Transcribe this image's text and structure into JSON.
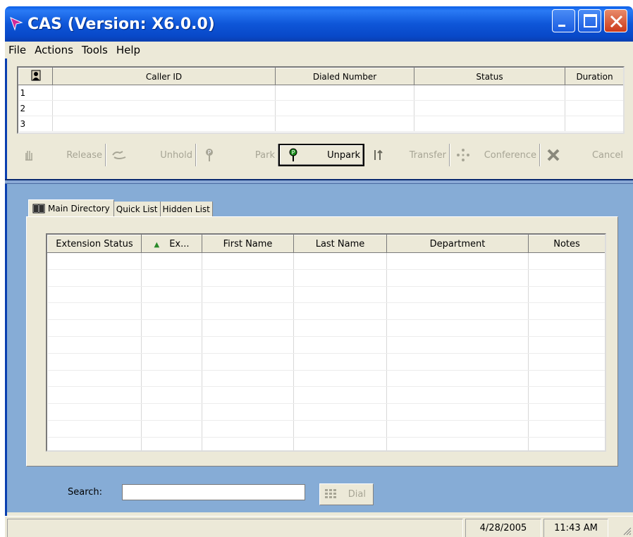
{
  "window": {
    "title": "CAS  (Version: X6.0.0)"
  },
  "menu": [
    "File",
    "Actions",
    "Tools",
    "Help"
  ],
  "calls_table": {
    "columns": [
      "Caller ID",
      "Dialed Number",
      "Status",
      "Duration"
    ],
    "rows": [
      {
        "num": "1",
        "caller_id": "",
        "dialed": "",
        "status": "",
        "duration": ""
      },
      {
        "num": "2",
        "caller_id": "",
        "dialed": "",
        "status": "",
        "duration": ""
      },
      {
        "num": "3",
        "caller_id": "",
        "dialed": "",
        "status": "",
        "duration": ""
      }
    ]
  },
  "toolbar": {
    "release": "Release",
    "unhold": "Unhold",
    "park": "Park",
    "unpark": "Unpark",
    "transfer": "Transfer",
    "conference": "Conference",
    "cancel": "Cancel"
  },
  "tabs": {
    "main_directory": "Main Directory",
    "quick_list": "Quick List",
    "hidden_list": "Hidden List"
  },
  "directory": {
    "columns": [
      "Extension Status",
      "Ex...",
      "First Name",
      "Last Name",
      "Department",
      "Notes"
    ],
    "sorted_column": "Ex..."
  },
  "search": {
    "label": "Search:",
    "value": ""
  },
  "dial_button": "Dial",
  "status_bar": {
    "date": "4/28/2005",
    "time": "11:43 AM"
  },
  "colors": {
    "titlebar": "#0a52d8",
    "frame": "#ece9d8",
    "lower_pane": "#86acd6",
    "disabled_text": "#a7a595"
  }
}
